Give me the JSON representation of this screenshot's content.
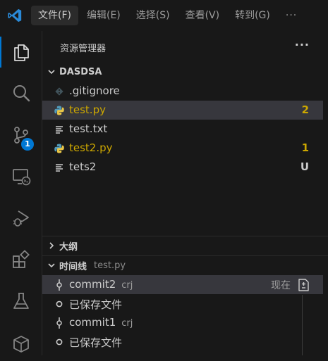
{
  "menu": {
    "items": [
      "文件(F)",
      "编辑(E)",
      "选择(S)",
      "查看(V)",
      "转到(G)"
    ],
    "more": "···"
  },
  "activity": {
    "scm_badge": "1"
  },
  "explorer": {
    "title": "资源管理器",
    "more": "···",
    "folder": "DASDSA",
    "files": [
      {
        "name": ".gitignore",
        "icon": "git-file-icon",
        "badge": ""
      },
      {
        "name": "test.py",
        "icon": "python-file-icon",
        "badge": "2",
        "selected": true,
        "status_color": "#cca700"
      },
      {
        "name": "test.txt",
        "icon": "text-file-icon",
        "badge": ""
      },
      {
        "name": "test2.py",
        "icon": "python-file-icon",
        "badge": "1",
        "status_color": "#cca700"
      },
      {
        "name": "tets2",
        "icon": "text-file-icon",
        "badge": "U"
      }
    ]
  },
  "outline": {
    "title": "大纲"
  },
  "timeline": {
    "title": "时间线",
    "file": "test.py",
    "entries": [
      {
        "label": "commit2",
        "author": "crj",
        "time": "现在",
        "icon": "git-commit-icon",
        "selected": true
      },
      {
        "label": "已保存文件",
        "author": "",
        "time": "",
        "icon": "circle-icon"
      },
      {
        "label": "commit1",
        "author": "crj",
        "time": "",
        "icon": "git-commit-icon"
      },
      {
        "label": "已保存文件",
        "author": "",
        "time": "",
        "icon": "circle-icon"
      }
    ]
  },
  "colors": {
    "accent": "#0078d4",
    "modified": "#cca700",
    "python_blue": "#519aba",
    "python_yellow": "#e8c547"
  }
}
